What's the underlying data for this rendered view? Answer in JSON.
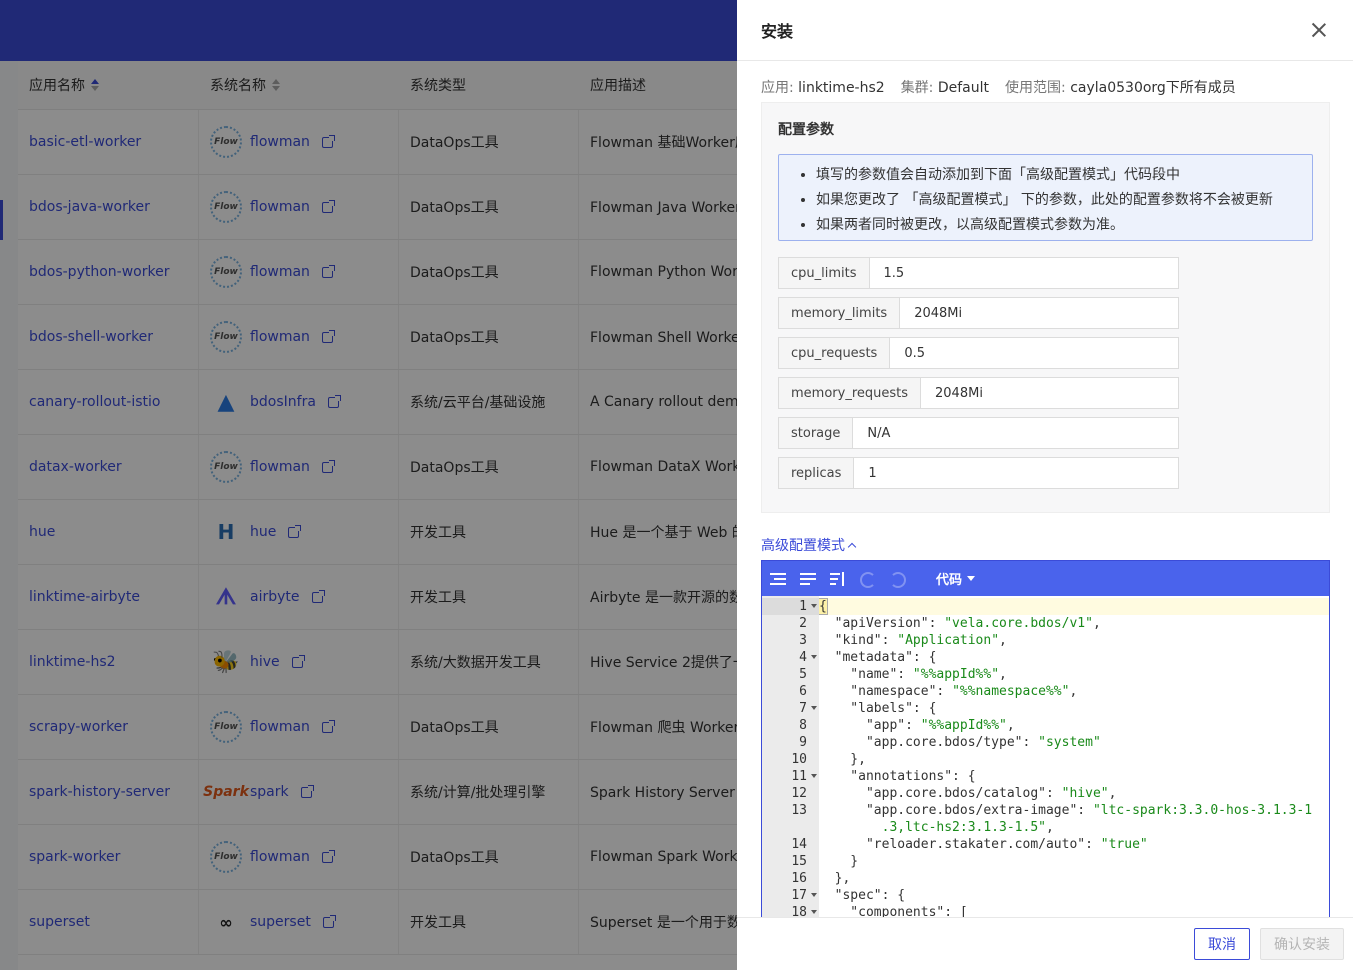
{
  "background_table": {
    "headers": [
      "应用名称",
      "系统名称",
      "系统类型",
      "应用描述"
    ],
    "rows": [
      {
        "name": "basic-etl-worker",
        "sys": "flowman",
        "logo": "flowman",
        "type": "DataOps工具",
        "desc": "Flowman 基础Worker应"
      },
      {
        "name": "bdos-java-worker",
        "sys": "flowman",
        "logo": "flowman",
        "type": "DataOps工具",
        "desc": "Flowman Java Worker应"
      },
      {
        "name": "bdos-python-worker",
        "sys": "flowman",
        "logo": "flowman",
        "type": "DataOps工具",
        "desc": "Flowman Python Worke"
      },
      {
        "name": "bdos-shell-worker",
        "sys": "flowman",
        "logo": "flowman",
        "type": "DataOps工具",
        "desc": "Flowman Shell Worker应"
      },
      {
        "name": "canary-rollout-istio",
        "sys": "bdosInfra",
        "logo": "bdos",
        "type": "系统/云平台/基础设施",
        "desc": "A Canary rollout demo"
      },
      {
        "name": "datax-worker",
        "sys": "flowman",
        "logo": "flowman",
        "type": "DataOps工具",
        "desc": "Flowman DataX Worke"
      },
      {
        "name": "hue",
        "sys": "hue",
        "logo": "hue",
        "type": "开发工具",
        "desc": "Hue 是一个基于 Web 的"
      },
      {
        "name": "linktime-airbyte",
        "sys": "airbyte",
        "logo": "airbyte",
        "type": "开发工具",
        "desc": "Airbyte 是一款开源的数"
      },
      {
        "name": "linktime-hs2",
        "sys": "hive",
        "logo": "hive",
        "type": "系统/大数据开发工具",
        "desc": "Hive Service 2提供了一"
      },
      {
        "name": "scrapy-worker",
        "sys": "flowman",
        "logo": "flowman",
        "type": "DataOps工具",
        "desc": "Flowman 爬虫 Worker应"
      },
      {
        "name": "spark-history-server",
        "sys": "spark",
        "logo": "spark",
        "type": "系统/计算/批处理引擎",
        "desc": "Spark History Server 是"
      },
      {
        "name": "spark-worker",
        "sys": "flowman",
        "logo": "flowman",
        "type": "DataOps工具",
        "desc": "Flowman Spark Worke"
      },
      {
        "name": "superset",
        "sys": "superset",
        "logo": "superset",
        "type": "开发工具",
        "desc": "Superset 是一个用于数"
      }
    ]
  },
  "drawer": {
    "title": "安装",
    "meta": {
      "app_key": "应用:",
      "app_val": "linktime-hs2",
      "cluster_key": "集群:",
      "cluster_val": "Default",
      "scope_key": "使用范围:",
      "scope_val": "cayla0530org下所有成员"
    },
    "config_title": "配置参数",
    "info": [
      "填写的参数值会自动添加到下面「高级配置模式」代码段中",
      "如果您更改了 「高级配置模式」 下的参数，此处的配置参数将不会被更新",
      "如果两者同时被更改，以高级配置模式参数为准。"
    ],
    "params": [
      {
        "label": "cpu_limits",
        "value": "1.5"
      },
      {
        "label": "memory_limits",
        "value": "2048Mi"
      },
      {
        "label": "cpu_requests",
        "value": "0.5"
      },
      {
        "label": "memory_requests",
        "value": "2048Mi"
      },
      {
        "label": "storage",
        "value": "N/A"
      },
      {
        "label": "replicas",
        "value": "1"
      }
    ],
    "advanced_label": "高级配置模式",
    "editor_mode": "代码",
    "code_lines": [
      {
        "n": "1",
        "fold": true,
        "html": "<span style=\"background:#fdf1a8;outline:1px solid #aaa\">{</span>"
      },
      {
        "n": "2",
        "html": "  \"apiVersion\": <span class=\"str\">\"vela.core.bdos/v1\"</span>,"
      },
      {
        "n": "3",
        "html": "  \"kind\": <span class=\"str\">\"Application\"</span>,"
      },
      {
        "n": "4",
        "fold": true,
        "html": "  \"metadata\": {"
      },
      {
        "n": "5",
        "html": "    \"name\": <span class=\"str\">\"%%appId%%\"</span>,"
      },
      {
        "n": "6",
        "html": "    \"namespace\": <span class=\"str\">\"%%namespace%%\"</span>,"
      },
      {
        "n": "7",
        "fold": true,
        "html": "    \"labels\": {"
      },
      {
        "n": "8",
        "html": "      \"app\": <span class=\"str\">\"%%appId%%\"</span>,"
      },
      {
        "n": "9",
        "html": "      \"app.core.bdos/type\": <span class=\"str\">\"system\"</span>"
      },
      {
        "n": "10",
        "html": "    },"
      },
      {
        "n": "11",
        "fold": true,
        "html": "    \"annotations\": {"
      },
      {
        "n": "12",
        "html": "      \"app.core.bdos/catalog\": <span class=\"str\">\"hive\"</span>,"
      },
      {
        "n": "13",
        "tall": true,
        "html": "      \"app.core.bdos/extra-image\": <span class=\"str\">\"ltc-spark:3.3.0-hos-3.1.3-1\n        .3,ltc-hs2:3.1.3-1.5\"</span>,"
      },
      {
        "n": "14",
        "html": "      \"reloader.stakater.com/auto\": <span class=\"str\">\"true\"</span>"
      },
      {
        "n": "15",
        "html": "    }"
      },
      {
        "n": "16",
        "html": "  },"
      },
      {
        "n": "17",
        "fold": true,
        "html": "  \"spec\": {"
      },
      {
        "n": "18",
        "fold": true,
        "html": "    \"components\": ["
      }
    ],
    "cancel_label": "取消",
    "confirm_label": "确认安装"
  }
}
